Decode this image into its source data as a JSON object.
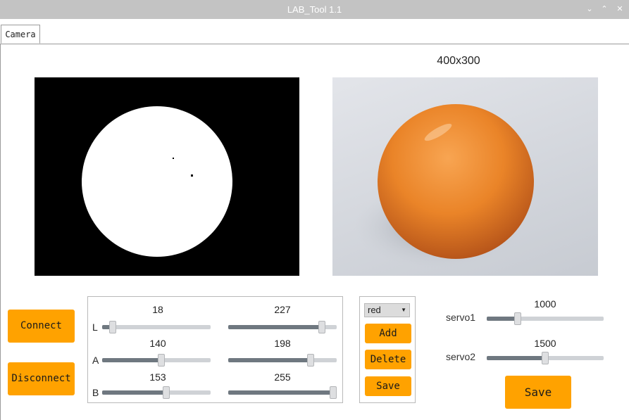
{
  "window": {
    "title": "LAB_Tool 1.1",
    "minimize": "⌄",
    "maximize": "⌃",
    "close": "✕"
  },
  "tabs": [
    {
      "label": "Camera"
    }
  ],
  "camera": {
    "resolution": "400x300"
  },
  "buttons": {
    "connect": "Connect",
    "disconnect": "Disconnect",
    "add": "Add",
    "delete": "Delete",
    "save_color": "Save",
    "save_servo": "Save"
  },
  "lab": {
    "range": [
      0,
      255
    ],
    "rows": [
      {
        "axis": "L",
        "min": 18,
        "max": 227
      },
      {
        "axis": "A",
        "min": 140,
        "max": 198
      },
      {
        "axis": "B",
        "min": 153,
        "max": 255
      }
    ]
  },
  "color_select": {
    "selected": "red"
  },
  "servos": [
    {
      "name": "servo1",
      "value": 1000,
      "range": [
        500,
        2500
      ]
    },
    {
      "name": "servo2",
      "value": 1500,
      "range": [
        500,
        2500
      ]
    }
  ],
  "colors": {
    "accent": "#ffa200",
    "titlebar": "#c3c3c3",
    "slider_fill": "#6f7880",
    "slider_track": "#cfd2d6"
  }
}
